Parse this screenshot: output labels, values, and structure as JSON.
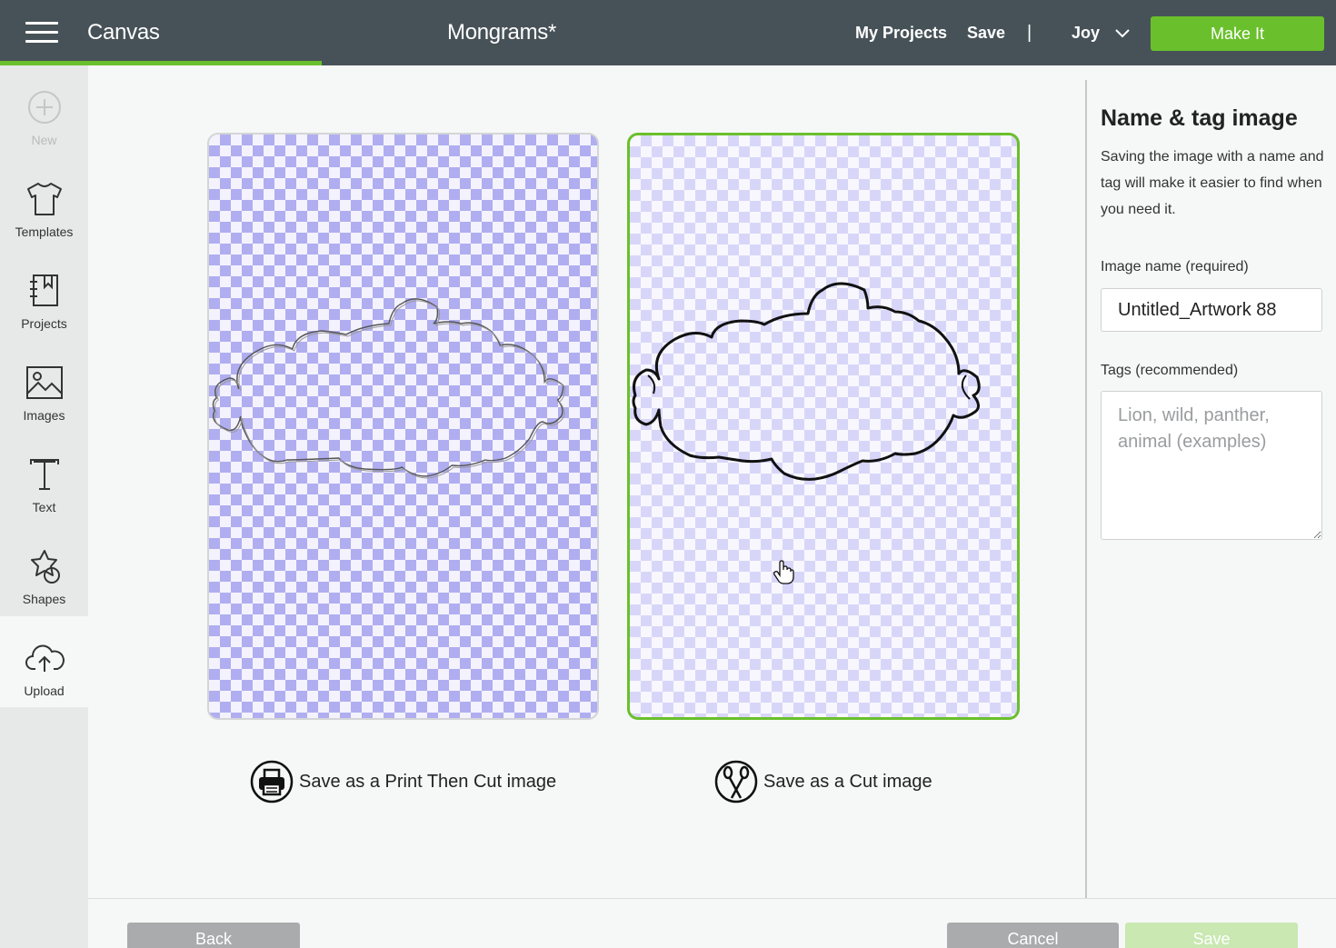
{
  "header": {
    "app_title": "Canvas",
    "doc_title": "Mongrams*",
    "my_projects": "My Projects",
    "save": "Save",
    "separator": "|",
    "user": "Joy",
    "make_it": "Make It"
  },
  "sidebar": {
    "items": [
      {
        "label": "New",
        "icon": "plus-circle-icon",
        "state": "disabled"
      },
      {
        "label": "Templates",
        "icon": "tshirt-icon"
      },
      {
        "label": "Projects",
        "icon": "projects-icon"
      },
      {
        "label": "Images",
        "icon": "image-icon"
      },
      {
        "label": "Text",
        "icon": "text-icon"
      },
      {
        "label": "Shapes",
        "icon": "shapes-icon"
      },
      {
        "label": "Upload",
        "icon": "upload-cloud-icon",
        "state": "active"
      }
    ]
  },
  "main": {
    "options": [
      {
        "label": "Save as a Print Then Cut image",
        "icon": "printer-icon",
        "selected": false
      },
      {
        "label": "Save as a Cut image",
        "icon": "scissors-icon",
        "selected": true
      }
    ]
  },
  "panel": {
    "title": "Name & tag image",
    "description": "Saving the image with a name and tag will make it easier to find when you need it.",
    "name_label": "Image name (required)",
    "name_value": "Untitled_Artwork 88",
    "tags_label": "Tags (recommended)",
    "tags_placeholder": "Lion, wild, panther, animal (examples)"
  },
  "footer": {
    "back": "Back",
    "cancel": "Cancel",
    "save": "Save"
  },
  "colors": {
    "header_bg": "#475258",
    "accent_green": "#6ac02c",
    "sidebar_bg": "#e7e8e8",
    "checker_dark": "#b0aef0",
    "checker_light": "#d8d6f8"
  }
}
